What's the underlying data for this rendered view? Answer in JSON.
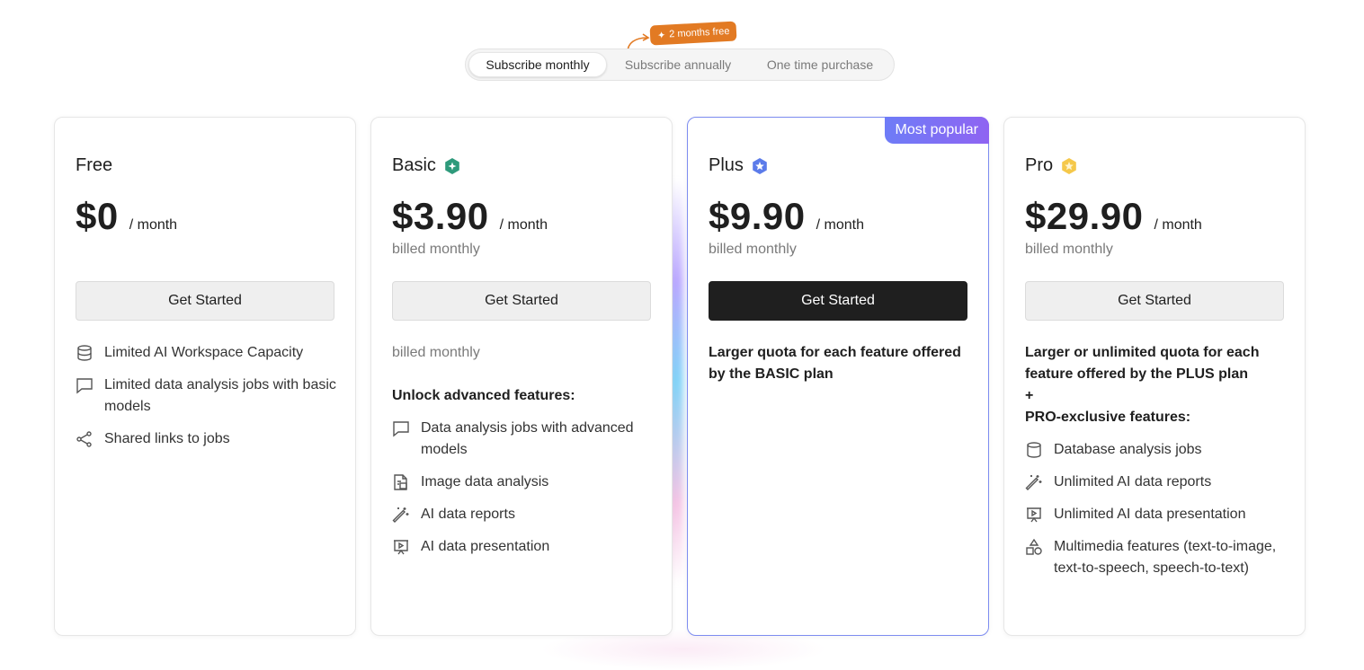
{
  "promo": {
    "label": "2 months free"
  },
  "billing_toggle": {
    "options": [
      "Subscribe monthly",
      "Subscribe annually",
      "One time purchase"
    ],
    "selected": "Subscribe monthly"
  },
  "plans": [
    {
      "name": "Free",
      "price": "$0",
      "period": "/ month",
      "cta": "Get Started",
      "features": [
        {
          "icon": "database-icon",
          "text": "Limited AI Workspace Capacity"
        },
        {
          "icon": "chat-icon",
          "text": "Limited data analysis jobs with basic models"
        },
        {
          "icon": "share-icon",
          "text": "Shared links to jobs"
        }
      ]
    },
    {
      "name": "Basic",
      "icon": "basic-badge-icon",
      "price": "$3.90",
      "period": "/ month",
      "billed": "billed monthly",
      "cta": "Get Started",
      "note": "billed monthly",
      "heading": "Unlock advanced features:",
      "features": [
        {
          "icon": "chat-icon",
          "text": "Data analysis jobs with advanced models"
        },
        {
          "icon": "image-file-icon",
          "text": "Image data analysis"
        },
        {
          "icon": "magic-wand-icon",
          "text": "AI data reports"
        },
        {
          "icon": "presentation-icon",
          "text": "AI data presentation"
        }
      ]
    },
    {
      "name": "Plus",
      "icon": "plus-badge-icon",
      "badge": "Most popular",
      "price": "$9.90",
      "period": "/ month",
      "billed": "billed monthly",
      "cta": "Get Started",
      "description": "Larger quota for each feature offered by the BASIC plan"
    },
    {
      "name": "Pro",
      "icon": "pro-badge-icon",
      "price": "$29.90",
      "period": "/ month",
      "billed": "billed monthly",
      "cta": "Get Started",
      "description_line1": "Larger or unlimited quota for each feature offered by the PLUS plan",
      "description_plus": "+",
      "description_line2": "PRO-exclusive features:",
      "features": [
        {
          "icon": "database-icon",
          "text": "Database analysis jobs"
        },
        {
          "icon": "magic-wand-icon",
          "text": "Unlimited AI data reports"
        },
        {
          "icon": "presentation-icon",
          "text": "Unlimited AI data presentation"
        },
        {
          "icon": "shapes-icon",
          "text": "Multimedia features (text-to-image, text-to-speech, speech-to-text)"
        }
      ]
    }
  ],
  "colors": {
    "accent_orange": "#e27a23",
    "badge_gradient_start": "#6e7cf7",
    "badge_gradient_end": "#8f64f2",
    "basic_icon": "#2e9a7b",
    "plus_icon": "#5b7bea",
    "pro_icon": "#f5c84a",
    "dark_button": "#1f1f1f"
  }
}
